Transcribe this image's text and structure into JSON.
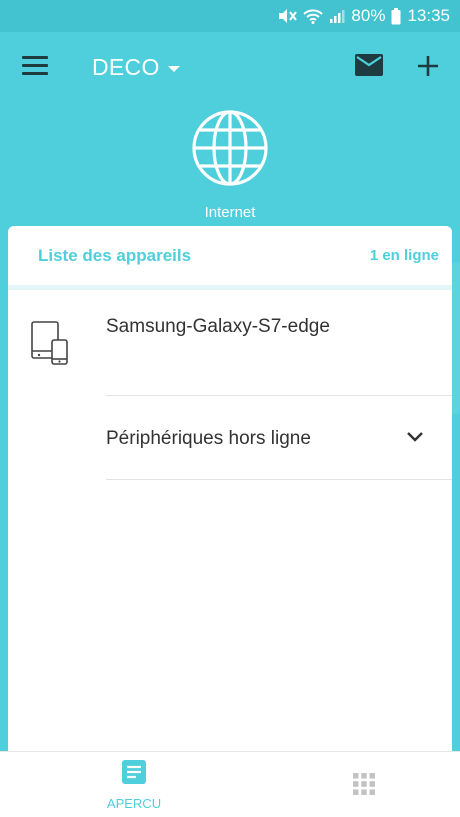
{
  "status_bar": {
    "battery": "80%",
    "time": "13:35",
    "icons": [
      "mute-icon",
      "wifi-icon",
      "signal-icon",
      "battery-icon"
    ]
  },
  "app_bar": {
    "title": "DECO",
    "menu_icon": "hamburger-menu-icon",
    "mail_icon": "mail-icon",
    "add_icon": "plus-icon"
  },
  "internet": {
    "label": "Internet",
    "icon": "globe-icon"
  },
  "device_list": {
    "title": "Liste des appareils",
    "online_count": "1 en ligne",
    "devices": [
      {
        "name": "Samsung-Galaxy-S7-edge",
        "icon": "tablet-phone-icon"
      }
    ],
    "offline_label": "Périphériques hors ligne"
  },
  "bottom_nav": {
    "tabs": [
      {
        "label": "APERCU",
        "icon": "document-icon",
        "active": true
      },
      {
        "label": "",
        "icon": "grid-icon",
        "active": false
      }
    ]
  },
  "colors": {
    "primary": "#4ecfdb",
    "status_bar": "#42c3cf",
    "dark_icon": "#1f3b40",
    "text": "#333333"
  }
}
